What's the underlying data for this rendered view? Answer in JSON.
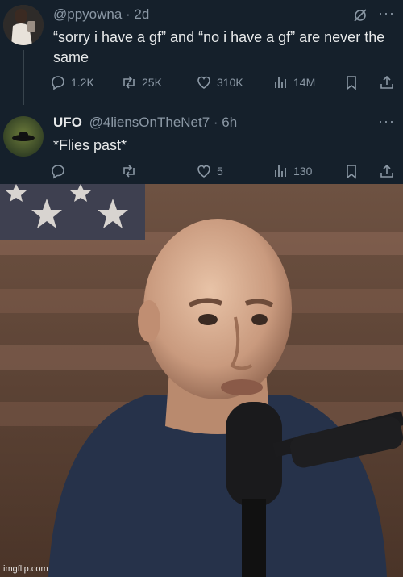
{
  "tweet1": {
    "handle": "@ppyowna",
    "time": "· 2d",
    "text": "“sorry i have a gf” and “no i have a gf” are never the same",
    "more": "···",
    "counts": {
      "replies": "1.2K",
      "retweets": "25K",
      "likes": "310K",
      "views": "14M"
    }
  },
  "tweet2": {
    "name": "UFO",
    "handle": "@4liensOnTheNet7",
    "time": "· 6h",
    "text": "*Flies past*",
    "more": "···",
    "counts": {
      "replies": "",
      "retweets": "",
      "likes": "5",
      "views": "130"
    }
  },
  "watermark": "imgflip.com",
  "colors": {
    "background": "#15202b",
    "text": "#e7e9ea",
    "muted": "#8b98a5"
  },
  "icons": [
    "reply-icon",
    "retweet-icon",
    "like-icon",
    "views-icon",
    "bookmark-icon",
    "share-icon",
    "grok-icon",
    "more-icon"
  ]
}
